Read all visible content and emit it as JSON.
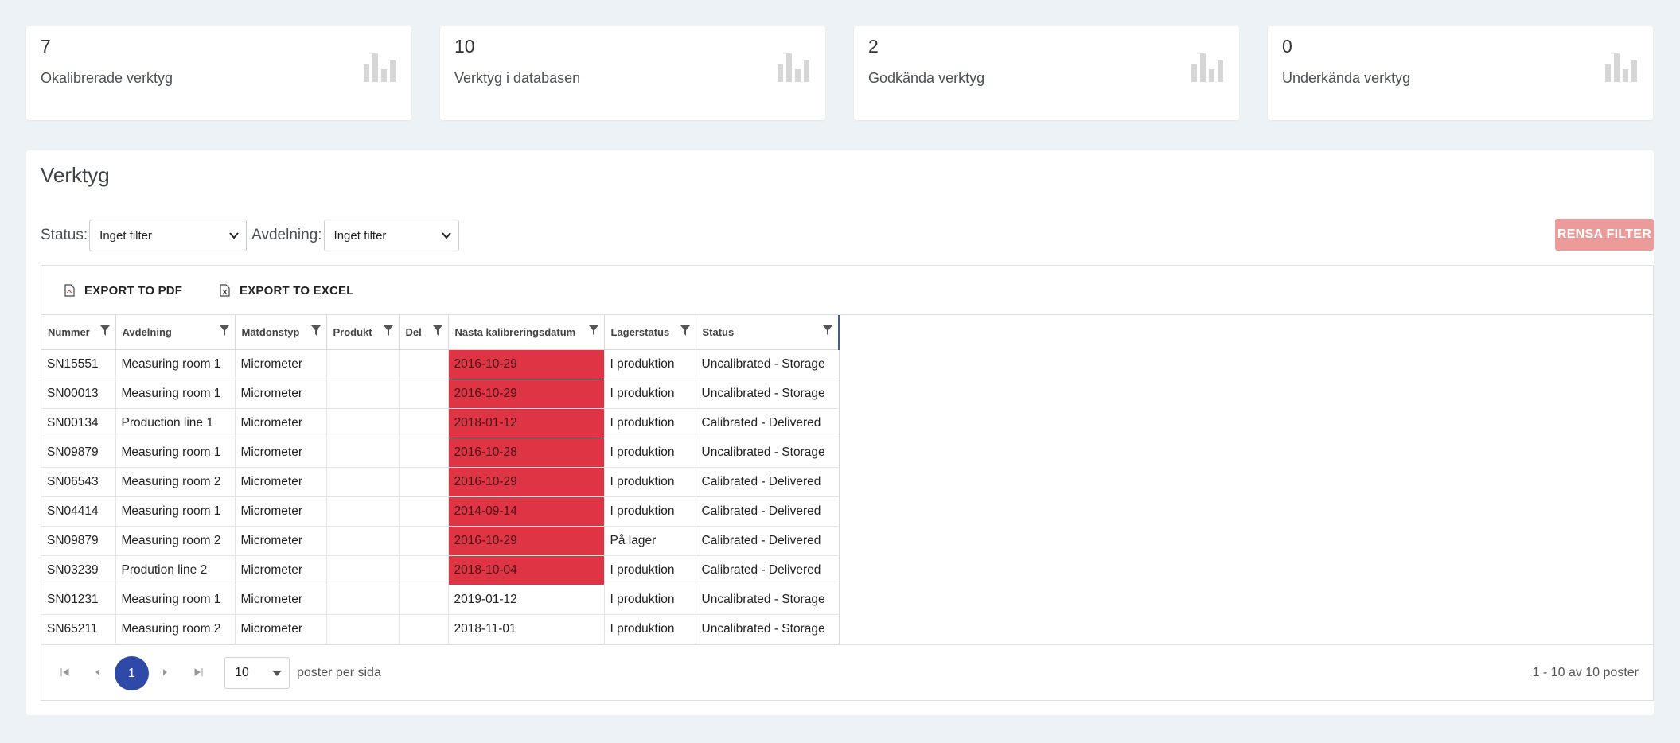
{
  "stats": [
    {
      "value": "7",
      "label": "Okalibrerade verktyg",
      "icon": "bar-chart-icon"
    },
    {
      "value": "10",
      "label": "Verktyg i databasen",
      "icon": "bar-chart-icon"
    },
    {
      "value": "2",
      "label": "Godkända verktyg",
      "icon": "bar-chart-icon"
    },
    {
      "value": "0",
      "label": "Underkända verktyg",
      "icon": "bar-chart-icon"
    }
  ],
  "panel": {
    "title": "Verktyg",
    "status_label": "Status:",
    "status_value": "Inget filter",
    "avdelning_label": "Avdelning:",
    "avdelning_value": "Inget filter",
    "clear_button": "RENSA FILTER"
  },
  "toolbar": {
    "pdf": "EXPORT TO PDF",
    "excel": "EXPORT TO EXCEL"
  },
  "table": {
    "columns": [
      "Nummer",
      "Avdelning",
      "Mätdonstyp",
      "Produkt",
      "Del",
      "Nästa kalibreringsdatum",
      "Lagerstatus",
      "Status"
    ],
    "rows": [
      {
        "nummer": "SN15551",
        "avdelning": "Measuring room 1",
        "typ": "Micrometer",
        "produkt": "",
        "del": "",
        "datum": "2016-10-29",
        "lager": "I produktion",
        "status": "Uncalibrated - Storage",
        "overdue": true
      },
      {
        "nummer": "SN00013",
        "avdelning": "Measuring room 1",
        "typ": "Micrometer",
        "produkt": "",
        "del": "",
        "datum": "2016-10-29",
        "lager": "I produktion",
        "status": "Uncalibrated - Storage",
        "overdue": true
      },
      {
        "nummer": "SN00134",
        "avdelning": "Production line 1",
        "typ": "Micrometer",
        "produkt": "",
        "del": "",
        "datum": "2018-01-12",
        "lager": "I produktion",
        "status": "Calibrated - Delivered",
        "overdue": true
      },
      {
        "nummer": "SN09879",
        "avdelning": "Measuring room 1",
        "typ": "Micrometer",
        "produkt": "",
        "del": "",
        "datum": "2016-10-28",
        "lager": "I produktion",
        "status": "Uncalibrated - Storage",
        "overdue": true
      },
      {
        "nummer": "SN06543",
        "avdelning": "Measuring room 2",
        "typ": "Micrometer",
        "produkt": "",
        "del": "",
        "datum": "2016-10-29",
        "lager": "I produktion",
        "status": "Calibrated - Delivered",
        "overdue": true
      },
      {
        "nummer": "SN04414",
        "avdelning": "Measuring room 1",
        "typ": "Micrometer",
        "produkt": "",
        "del": "",
        "datum": "2014-09-14",
        "lager": "I produktion",
        "status": "Calibrated - Delivered",
        "overdue": true
      },
      {
        "nummer": "SN09879",
        "avdelning": "Measuring room 2",
        "typ": "Micrometer",
        "produkt": "",
        "del": "",
        "datum": "2016-10-29",
        "lager": "På lager",
        "status": "Calibrated - Delivered",
        "overdue": true
      },
      {
        "nummer": "SN03239",
        "avdelning": "Prodution line 2",
        "typ": "Micrometer",
        "produkt": "",
        "del": "",
        "datum": "2018-10-04",
        "lager": "I produktion",
        "status": "Calibrated - Delivered",
        "overdue": true
      },
      {
        "nummer": "SN01231",
        "avdelning": "Measuring room 1",
        "typ": "Micrometer",
        "produkt": "",
        "del": "",
        "datum": "2019-01-12",
        "lager": "I produktion",
        "status": "Uncalibrated - Storage",
        "overdue": false
      },
      {
        "nummer": "SN65211",
        "avdelning": "Measuring room 2",
        "typ": "Micrometer",
        "produkt": "",
        "del": "",
        "datum": "2018-11-01",
        "lager": "I produktion",
        "status": "Uncalibrated - Storage",
        "overdue": false
      }
    ]
  },
  "pager": {
    "current_page": "1",
    "page_size": "10",
    "per_page_label": "poster per sida",
    "summary": "1 - 10 av 10 poster"
  },
  "colors": {
    "overdue": "#de3444",
    "accent": "#2f49a8",
    "clear_button": "#ec9b9b"
  }
}
